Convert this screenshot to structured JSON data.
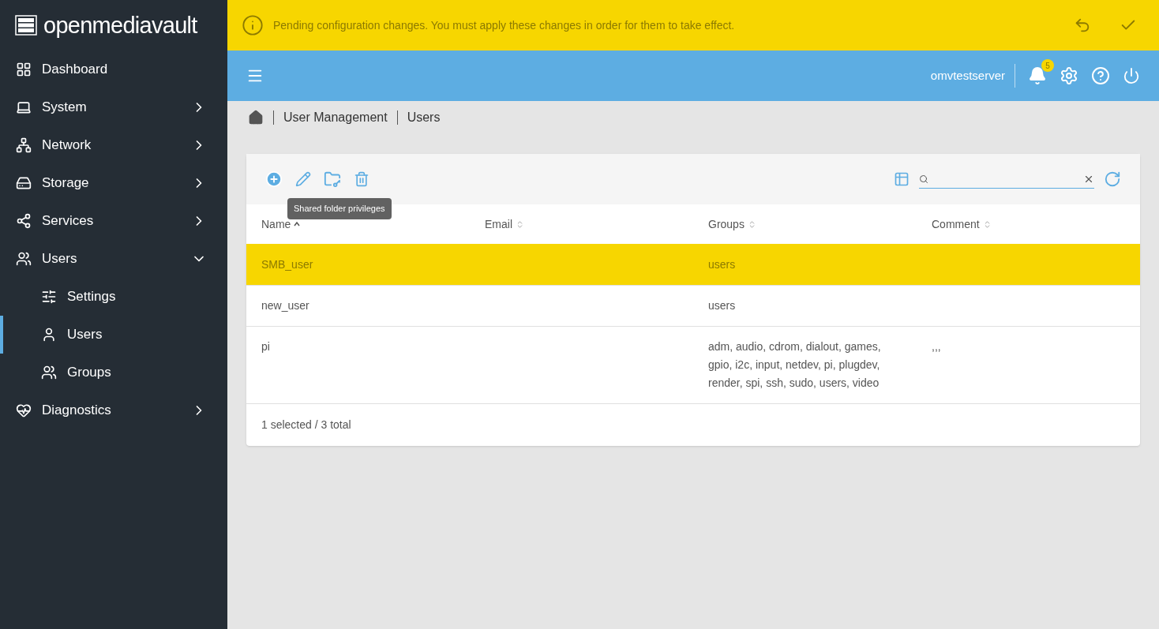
{
  "logo": {
    "text": "openmediavault"
  },
  "sidebar": {
    "items": [
      {
        "label": "Dashboard",
        "has_arrow": false,
        "selected": false
      },
      {
        "label": "System",
        "has_arrow": true,
        "expanded": false,
        "selected": false
      },
      {
        "label": "Network",
        "has_arrow": true,
        "expanded": false,
        "selected": false
      },
      {
        "label": "Storage",
        "has_arrow": true,
        "expanded": false,
        "selected": false
      },
      {
        "label": "Services",
        "has_arrow": true,
        "expanded": false,
        "selected": false
      },
      {
        "label": "Users",
        "has_arrow": true,
        "expanded": true,
        "selected": false,
        "children": [
          {
            "label": "Settings",
            "selected": false
          },
          {
            "label": "Users",
            "selected": true
          },
          {
            "label": "Groups",
            "selected": false
          }
        ]
      },
      {
        "label": "Diagnostics",
        "has_arrow": true,
        "expanded": false,
        "selected": false
      }
    ]
  },
  "banner": {
    "message": "Pending configuration changes. You must apply these changes in order for them to take effect."
  },
  "topbar": {
    "hostname": "omvtestserver",
    "notification_count": "5"
  },
  "breadcrumb": [
    "User Management",
    "Users"
  ],
  "toolbar": {
    "tooltip": "Shared folder privileges"
  },
  "table": {
    "columns": [
      {
        "label": "Name",
        "sorted": true
      },
      {
        "label": "Email",
        "sorted": false
      },
      {
        "label": "Groups",
        "sorted": false
      },
      {
        "label": "Comment",
        "sorted": false
      }
    ],
    "rows": [
      {
        "selected": true,
        "cells": [
          "SMB_user",
          "",
          "users",
          ""
        ]
      },
      {
        "selected": false,
        "cells": [
          "new_user",
          "",
          "users",
          ""
        ]
      },
      {
        "selected": false,
        "cells": [
          "pi",
          "",
          "adm, audio, cdrom, dialout, games, gpio, i2c, input, netdev, pi, plugdev, render, spi, ssh, sudo, users, video",
          ",,,"
        ]
      }
    ],
    "footer": "1 selected / 3 total"
  }
}
